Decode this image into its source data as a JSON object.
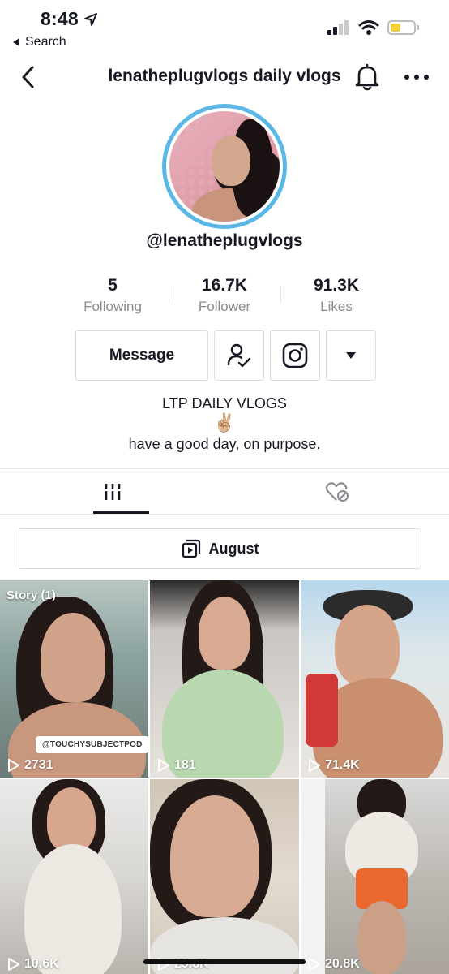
{
  "status_bar": {
    "time": "8:48",
    "back_label": "Search"
  },
  "header": {
    "title": "lenatheplugvlogs daily vlogs"
  },
  "profile": {
    "handle": "@lenatheplugvlogs",
    "stats": [
      {
        "value": "5",
        "label": "Following"
      },
      {
        "value": "16.7K",
        "label": "Follower"
      },
      {
        "value": "91.3K",
        "label": "Likes"
      }
    ],
    "message_label": "Message",
    "bio_title": "LTP DAILY VLOGS",
    "bio_emoji": "✌🏼",
    "bio_text": "have a good day, on purpose."
  },
  "playlist": {
    "label": "August"
  },
  "videos": [
    {
      "views": "2731",
      "story_badge": "Story (1)",
      "tag": "@TOUCHYSUBJECTPOD"
    },
    {
      "views": "181"
    },
    {
      "views": "71.4K"
    },
    {
      "views": "10.6K"
    },
    {
      "views": "29.8K"
    },
    {
      "views": "20.8K"
    }
  ],
  "colors": {
    "avatar_ring": "#5ab7e6",
    "text_primary": "#161823",
    "text_secondary": "#8a8b91",
    "border": "#dcdcdf"
  }
}
